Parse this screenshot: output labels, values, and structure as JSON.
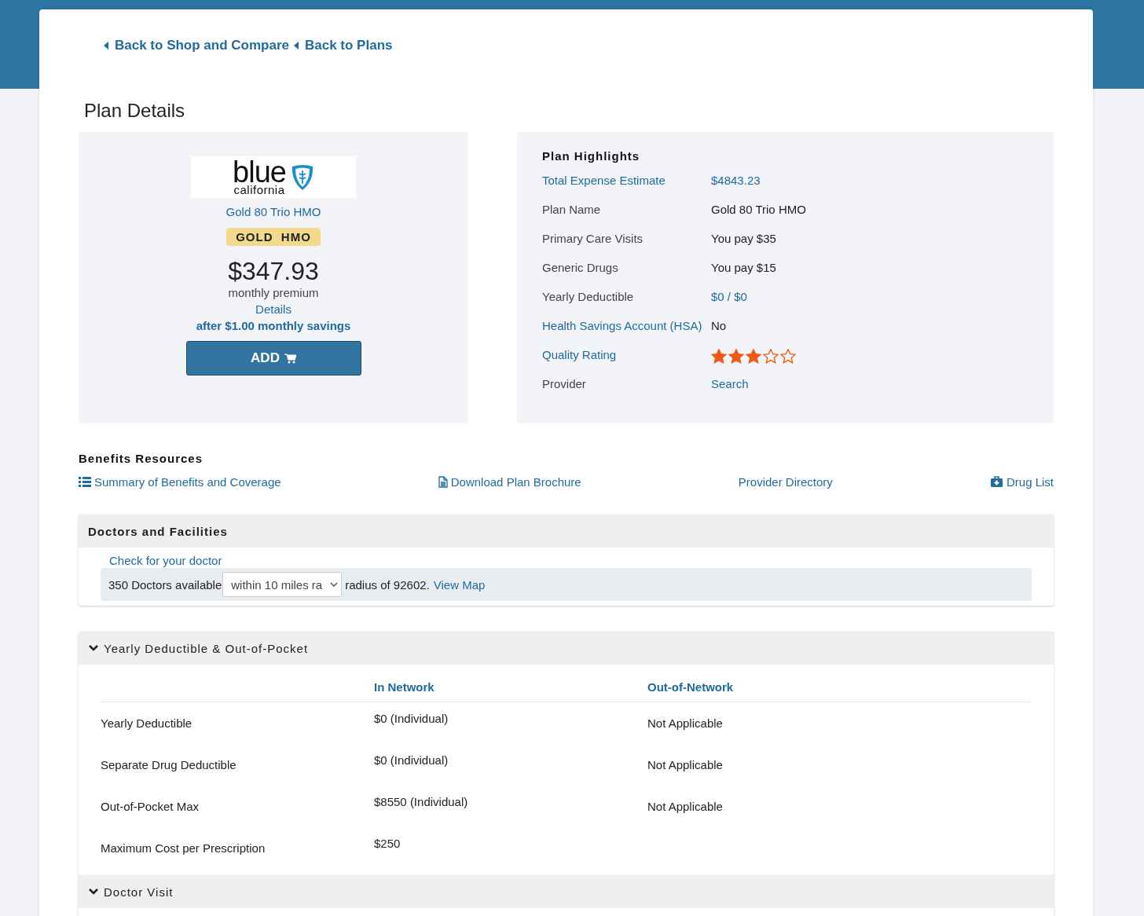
{
  "back_links": [
    "Back to Shop and Compare",
    "Back to Plans"
  ],
  "page_title": "Plan Details",
  "plan_card": {
    "logo": {
      "word": "blue",
      "sub": "california"
    },
    "plan_name": "Gold 80 Trio HMO",
    "badge": "GOLD  HMO",
    "price": "$347.93",
    "price_note": "monthly premium",
    "details_link": "Details",
    "savings": "after $1.00 monthly savings",
    "add_button": "ADD"
  },
  "highlights": {
    "title": "Plan Highlights",
    "rows": [
      {
        "label": "Total Expense Estimate",
        "label_link": true,
        "kind": "link",
        "value": "$4843.23"
      },
      {
        "label": "Plan Name",
        "label_link": false,
        "kind": "text",
        "value": "Gold 80 Trio HMO"
      },
      {
        "label": "Primary Care Visits",
        "label_link": false,
        "kind": "text",
        "value": "You pay $35"
      },
      {
        "label": "Generic Drugs",
        "label_link": false,
        "kind": "text",
        "value": "You pay $15"
      },
      {
        "label": "Yearly Deductible",
        "label_link": false,
        "kind": "link",
        "value": "$0 / $0"
      },
      {
        "label": "Health Savings Account (HSA)",
        "label_link": true,
        "kind": "text",
        "value": "No"
      },
      {
        "label": "Quality Rating",
        "label_link": true,
        "kind": "stars",
        "stars": 3
      },
      {
        "label": "Provider",
        "label_link": false,
        "kind": "link",
        "value": "Search"
      }
    ]
  },
  "benefits_resources": {
    "title": "Benefits Resources",
    "links": [
      {
        "label": "Summary of Benefits and Coverage",
        "kind": "list"
      },
      {
        "label": "Download Plan Brochure",
        "kind": "document"
      },
      {
        "label": "Provider Directory",
        "kind": "plain"
      },
      {
        "label": "Drug List",
        "kind": "medkit"
      }
    ]
  },
  "doctors": {
    "title": "Doctors and Facilities",
    "check_link": "Check for your doctor",
    "count": "350 Doctors available",
    "radius_select": "within 10 miles ra",
    "radius_text": "radius of 92602.",
    "map_link": "View Map"
  },
  "sections": [
    {
      "title": "Yearly Deductible & Out-of-Pocket",
      "expanded": true,
      "columns": [
        "In Network",
        "Out-of-Network"
      ],
      "rows": [
        {
          "label": "Yearly Deductible",
          "in_network": "$0 (Individual)",
          "out_of_network": "Not Applicable"
        },
        {
          "label": "Separate Drug Deductible",
          "in_network": "$0 (Individual)",
          "out_of_network": "Not Applicable"
        },
        {
          "label": "Out-of-Pocket Max",
          "in_network": "$8550 (Individual)",
          "out_of_network": "Not Applicable"
        },
        {
          "label": "Maximum Cost per Prescription",
          "in_network": "$250"
        }
      ]
    },
    {
      "title": "Doctor Visit",
      "expanded": true
    }
  ]
}
